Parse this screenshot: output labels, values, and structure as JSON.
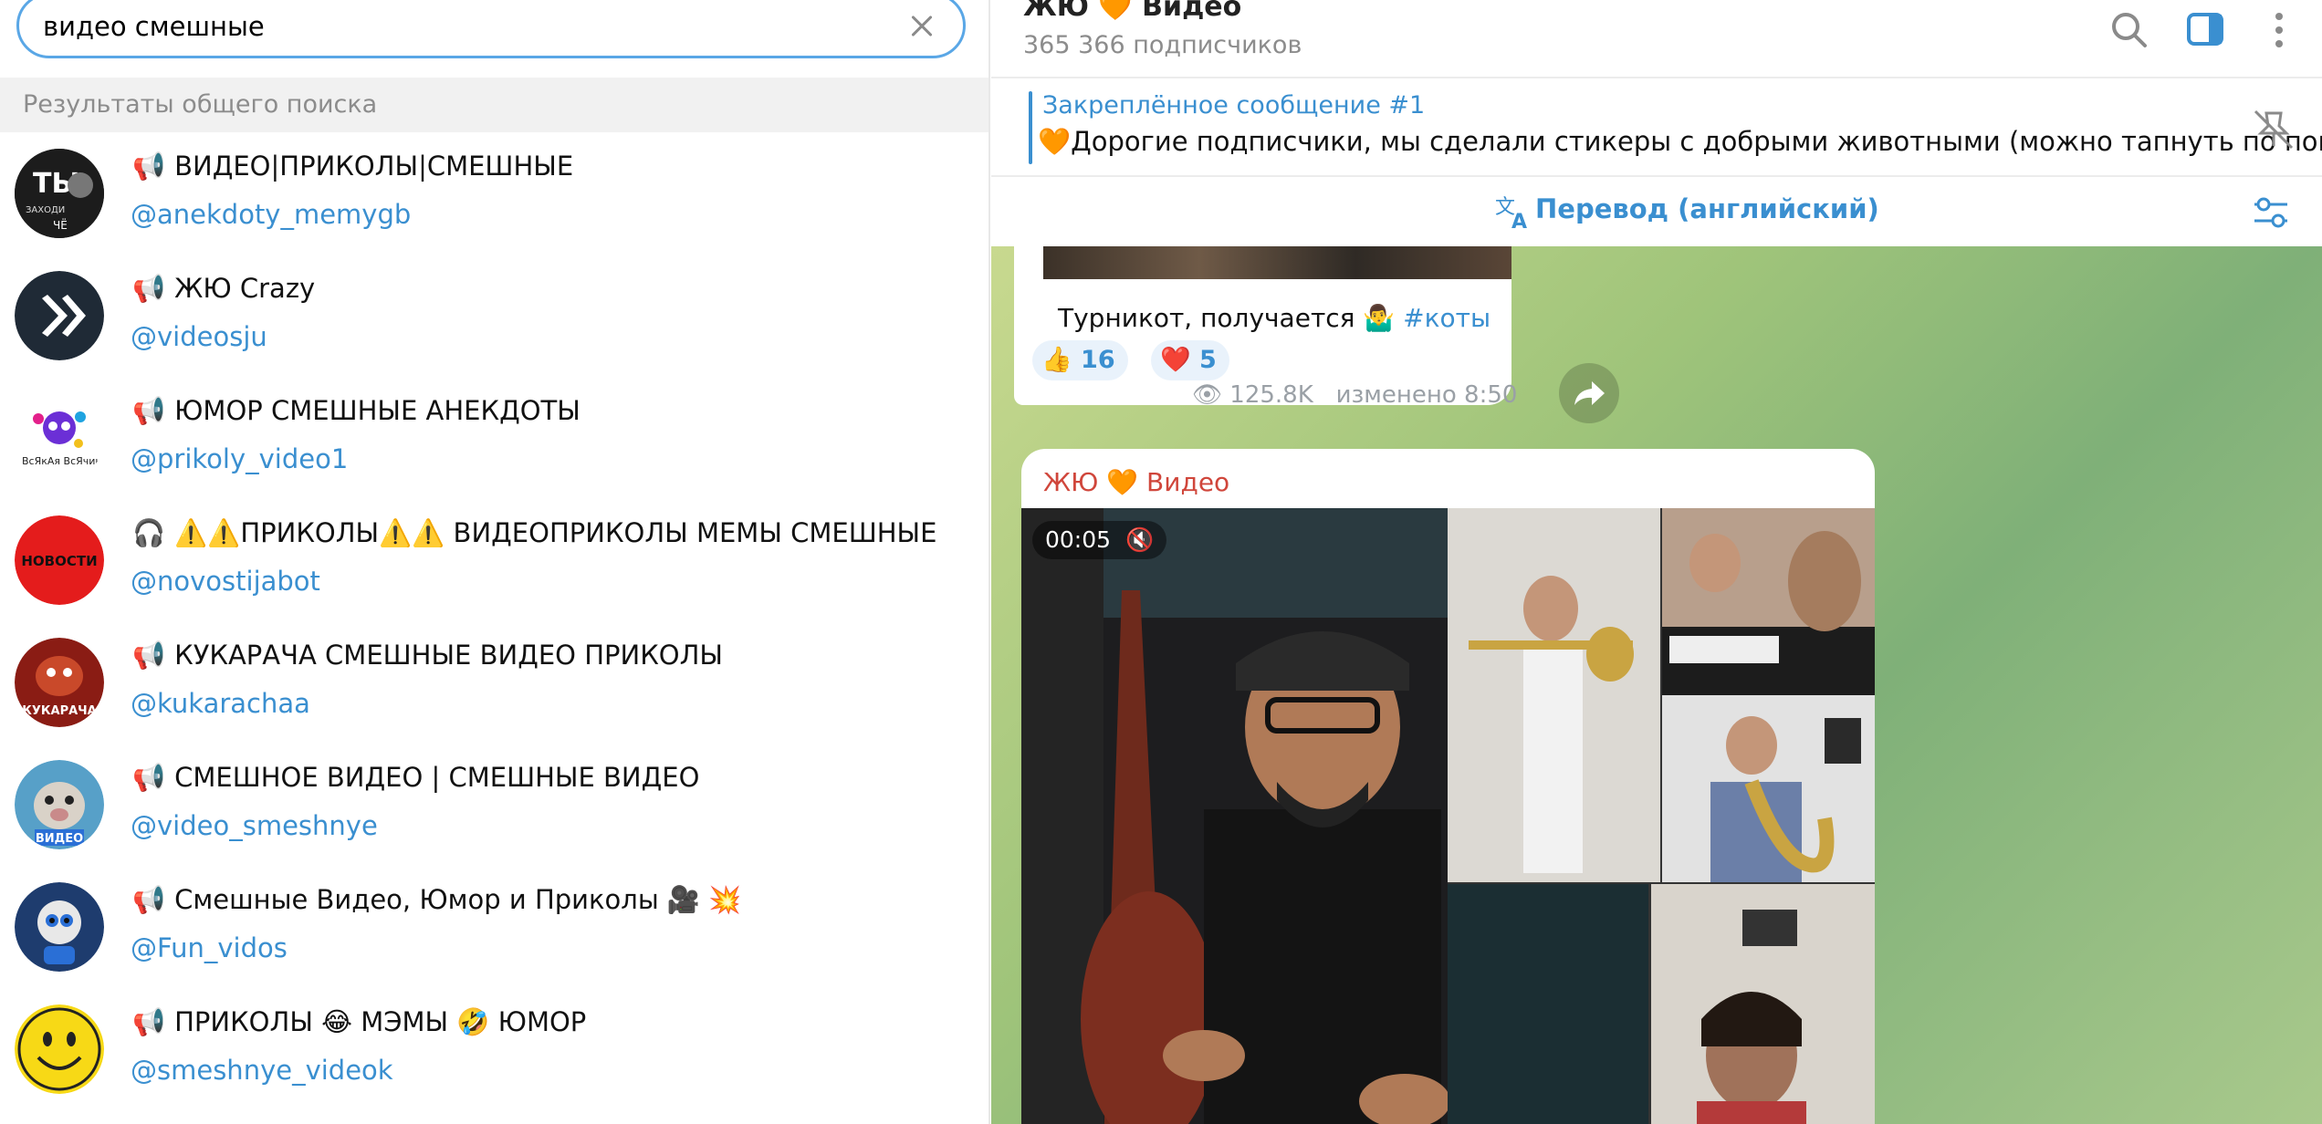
{
  "search": {
    "value": "видео смешные",
    "clear_icon": "close-icon"
  },
  "results_header": "Результаты общего поиска",
  "results": [
    {
      "title": "ВИДЕО|ПРИКОЛЫ|СМЕШНЫЕ",
      "username": "@anekdoty_memygb",
      "avatar_color": "#1c1c1c",
      "avatar_text": "ТЫ"
    },
    {
      "title": "ЖЮ Crazy",
      "username": "@videosju",
      "avatar_color": "#1f2a36",
      "avatar_text": "»"
    },
    {
      "title": "ЮМОР СМЕШНЫЕ АНЕКДОТЫ",
      "username": "@prikoly_video1",
      "avatar_color": "#ffffff",
      "avatar_text": ""
    },
    {
      "title": "⚠️⚠️ПРИКОЛЫ⚠️⚠️ ВИДЕОПРИКОЛЫ МЕМЫ СМЕШНЫЕ",
      "username": "@novostijabot",
      "avatar_color": "#e41c1c",
      "avatar_text": "НОВОСТИ",
      "prefix_icon": "headphones-icon"
    },
    {
      "title": "КУКАРАЧА СМЕШНЫЕ ВИДЕО ПРИКОЛЫ",
      "username": "@kukarachaa",
      "avatar_color": "#b3281e",
      "avatar_text": "КУКАРАЧА"
    },
    {
      "title": "СМЕШНОЕ ВИДЕО | СМЕШНЫЕ ВИДЕО",
      "username": "@video_smeshnye",
      "avatar_color": "#57a0c8",
      "avatar_text": "ВИДЕО"
    },
    {
      "title": "Смешные Видео, Юмор и Приколы 🎥 💥",
      "username": "@Fun_vidos",
      "avatar_color": "#1e3c6e",
      "avatar_text": ""
    },
    {
      "title": "ПРИКОЛЫ 😂 МЭМЫ 🤣 ЮМОР",
      "username": "@smeshnye_videok",
      "avatar_color": "#f7d916",
      "avatar_text": ""
    }
  ],
  "channel": {
    "title": "ЖЮ 🧡 Видео",
    "subscribers": "365 366 подписчиков"
  },
  "pinned": {
    "title": "Закреплённое сообщение #1",
    "text": "🧡Дорогие подписчики, мы сделали стикеры с добрыми животными (можно тапнуть по поп..."
  },
  "translate": {
    "label": "Перевод (английский)"
  },
  "message1": {
    "text": "Турникот, получается 🤷‍♂️",
    "hashtag": "#коты",
    "reactions": [
      {
        "emoji": "👍",
        "count": "16"
      },
      {
        "emoji": "❤️",
        "count": "5"
      }
    ],
    "views": "125.8K",
    "edited": "изменено 8:50"
  },
  "message2": {
    "sender": "ЖЮ 🧡 Видео",
    "duration": "00:05"
  },
  "colors": {
    "accent": "#3a8fd0",
    "search_border": "#5aa7e6",
    "sender": "#d0463b"
  }
}
